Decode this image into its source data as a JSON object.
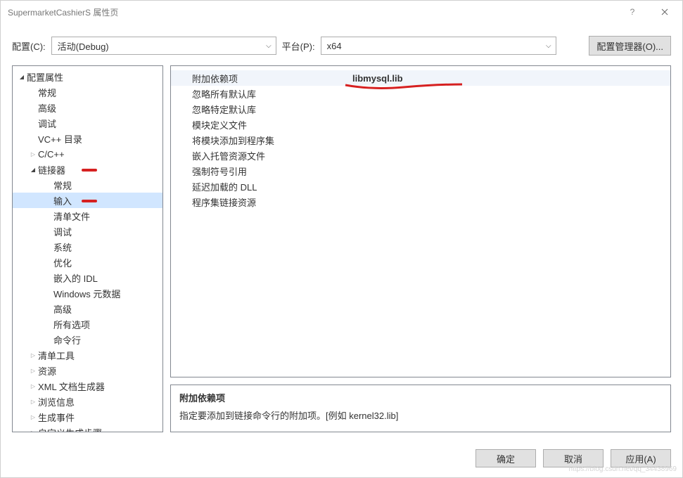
{
  "window": {
    "title": "SupermarketCashierS 属性页"
  },
  "toolbar": {
    "config_label": "配置(C):",
    "config_value": "活动(Debug)",
    "platform_label": "平台(P):",
    "platform_value": "x64",
    "config_manager": "配置管理器(O)..."
  },
  "tree": {
    "root": "配置属性",
    "items": {
      "general": "常规",
      "advanced": "高级",
      "debug": "调试",
      "vcpp": "VC++ 目录",
      "ccpp": "C/C++",
      "linker": "链接器",
      "linker_general": "常规",
      "linker_input": "输入",
      "linker_manifest": "清单文件",
      "linker_debug": "调试",
      "linker_system": "系统",
      "linker_optimize": "优化",
      "linker_idl": "嵌入的 IDL",
      "linker_winmeta": "Windows 元数据",
      "linker_advanced": "高级",
      "linker_all": "所有选项",
      "linker_cmdline": "命令行",
      "manifest_tool": "清单工具",
      "resources": "资源",
      "xml_doc": "XML 文档生成器",
      "browse_info": "浏览信息",
      "build_events": "生成事件",
      "custom_build": "自定义生成步骤"
    }
  },
  "props": {
    "rows": [
      {
        "label": "附加依赖项",
        "value": "libmysql.lib",
        "selected": true,
        "mark": true
      },
      {
        "label": "忽略所有默认库",
        "value": ""
      },
      {
        "label": "忽略特定默认库",
        "value": ""
      },
      {
        "label": "模块定义文件",
        "value": ""
      },
      {
        "label": "将模块添加到程序集",
        "value": ""
      },
      {
        "label": "嵌入托管资源文件",
        "value": ""
      },
      {
        "label": "强制符号引用",
        "value": ""
      },
      {
        "label": "延迟加载的 DLL",
        "value": ""
      },
      {
        "label": "程序集链接资源",
        "value": ""
      }
    ]
  },
  "description": {
    "title": "附加依赖项",
    "text": "指定要添加到链接命令行的附加项。[例如 kernel32.lib]"
  },
  "footer": {
    "ok": "确定",
    "cancel": "取消",
    "apply": "应用(A)"
  }
}
